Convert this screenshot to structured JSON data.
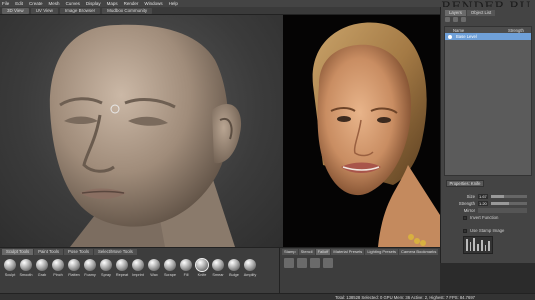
{
  "menubar": [
    "File",
    "Edit",
    "Create",
    "Mesh",
    "Curves",
    "Display",
    "Maps",
    "Render",
    "Windows",
    "Help"
  ],
  "tabs": [
    "3D View",
    "UV View",
    "Image Browser",
    "Mudbox Community"
  ],
  "watermark": "RENDER.RU",
  "right_panel": {
    "tabs": [
      "Layers",
      "Object List"
    ],
    "layers_header": [
      "Name",
      "Strength"
    ],
    "layer": "Base Level",
    "properties_button": "Properties: Knife",
    "properties": [
      {
        "label": "Size",
        "value": "1.67",
        "fill": 0.35
      },
      {
        "label": "Strength",
        "value": "1.20",
        "fill": 0.5
      }
    ],
    "mirror_label": "Mirror",
    "invert_label": "Invert Function",
    "stamp_label": "Use Stamp Image"
  },
  "sculpt_tabs": [
    "Sculpt Tools",
    "Paint Tools",
    "Pose Tools",
    "Select/Move Tools"
  ],
  "tools": [
    "Sculpt",
    "Smooth",
    "Grab",
    "Pinch",
    "Flatten",
    "Foamy",
    "Spray",
    "Repeat",
    "Imprint",
    "Wax",
    "Scrape",
    "Fill",
    "Knife",
    "Smear",
    "Bulge",
    "Amplify"
  ],
  "selected_tool": "Knife",
  "library_tabs": [
    "Stamp",
    "Stencil",
    "Falloff",
    "Material Presets",
    "Lighting Presets",
    "Camera Bookmarks"
  ],
  "status": "Total: 138528  Selected: 0  GPU Mem: 36  Active: 2, Highest: 7  FPS: 84.7697",
  "colors": {
    "panel_bg": "#444444",
    "layer_highlight": "#6fa0d8",
    "viewport_bg": "#4a4a4a"
  }
}
